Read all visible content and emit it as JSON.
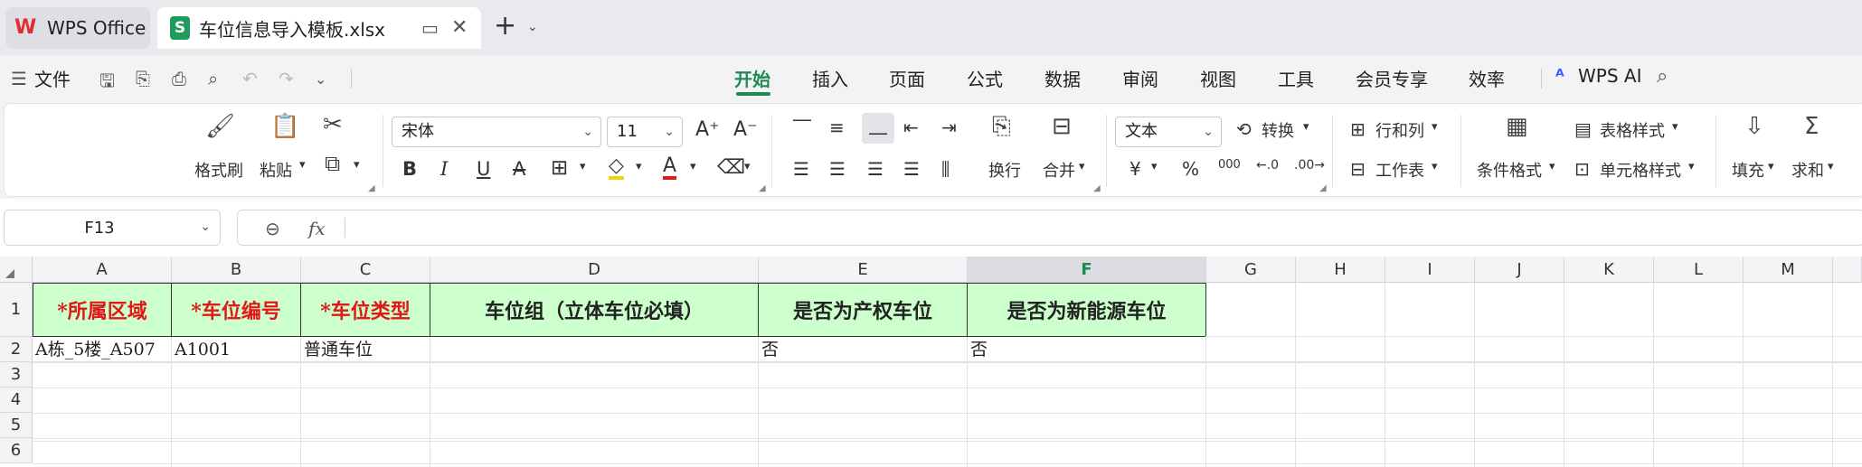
{
  "tabs": {
    "home_label": "WPS Office",
    "file_label": "车位信息导入模板.xlsx"
  },
  "menu": {
    "file_label": "文件",
    "items": [
      "开始",
      "插入",
      "页面",
      "公式",
      "数据",
      "审阅",
      "视图",
      "工具",
      "会员专享",
      "效率"
    ],
    "active": "开始",
    "ai_label": "WPS AI"
  },
  "ribbon": {
    "format_painter": "格式刷",
    "paste": "粘贴",
    "font_name": "宋体",
    "font_size": "11",
    "wrap": "换行",
    "merge": "合并",
    "number_format": "文本",
    "convert": "转换",
    "rows_cols": "行和列",
    "worksheet": "工作表",
    "conditional_format": "条件格式",
    "table_style": "表格样式",
    "cell_style": "单元格样式",
    "fill": "填充",
    "sum": "求和",
    "currency_symbol": "¥",
    "percent_symbol": "%",
    "thousands_symbol": "000"
  },
  "formula_bar": {
    "name_box": "F13",
    "fx_label": "fx",
    "content": ""
  },
  "sheet": {
    "columns": [
      "A",
      "B",
      "C",
      "D",
      "E",
      "F",
      "G",
      "H",
      "I",
      "J",
      "K",
      "L",
      "M"
    ],
    "selected_column": "F",
    "rows": [
      "1",
      "2",
      "3",
      "4",
      "5",
      "6"
    ],
    "header_row": [
      "*所属区域",
      "*车位编号",
      "*车位类型",
      "车位组（立体车位必填）",
      "是否为产权车位",
      "是否为新能源车位"
    ],
    "data_row_2": [
      "A栋_5楼_A507",
      "A1001",
      "普通车位",
      "",
      "否",
      "否"
    ],
    "colors": {
      "header_fill": "#ccffcc",
      "required_text": "#e01818",
      "accent": "#1c8a52"
    }
  }
}
